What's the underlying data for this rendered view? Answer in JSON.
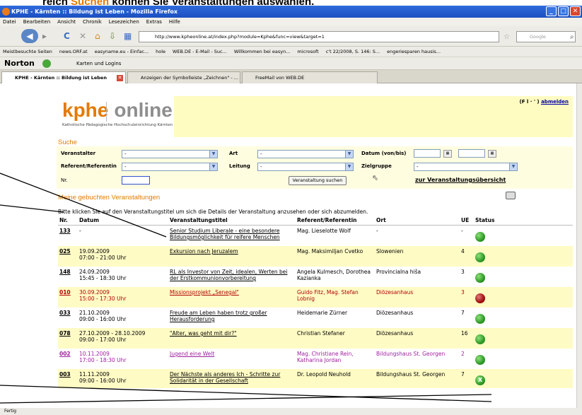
{
  "caption": {
    "prefix": "reich ",
    "highlight": "Suchen",
    "suffix": " können Sie Veranstaltungen auswählen."
  },
  "window": {
    "title": "KPHE - Kärnten :: Bildung ist Leben - Mozilla Firefox"
  },
  "menu": [
    "Datei",
    "Bearbeiten",
    "Ansicht",
    "Chronik",
    "Lesezeichen",
    "Extras",
    "Hilfe"
  ],
  "url": "http://www.kpheonline.at/index.php?module=Kphe&func=view&target=1",
  "search_engine": "Google",
  "bookmarks": [
    "Meistbesuchte Seiten",
    "news.ORF.at",
    "easyname.eu - Einfac...",
    "hole",
    "WEB.DE - E-Mail - Suc...",
    "Willkommen bei easyn...",
    "microsoft",
    "c't 22/2008, S. 146: S...",
    "engeriesparen hausis..."
  ],
  "norton": {
    "label": "Norton",
    "karten": "Karten und Logins"
  },
  "tabs": [
    "KPHE - Kärnten :: Bildung ist Leben",
    "Anzeigen der Symbolleiste „Zeichnen\" - ...",
    "FreeMail von WEB.DE"
  ],
  "statusbar": "Fertig",
  "page": {
    "logo_kphe": "kphe",
    "logo_online": "online",
    "logo_sub": "Katholische Pädagogische Hochschuleinrichtung Kärnten",
    "user_prefix": "(F  l  ·  ' )",
    "logout": "abmelden",
    "search": {
      "title": "Suche",
      "veranstalter": "Veranstalter",
      "art": "Art",
      "datum": "Datum (von/bis)",
      "referent": "Referent/Referentin",
      "leitung": "Leitung",
      "zielgruppe": "Zielgruppe",
      "nr": "Nr.",
      "select_default": "-",
      "button": "Veranstaltung suchen",
      "overview": "zur Veranstaltungsübersicht"
    },
    "booked": {
      "title": "Meine gebuchten Veranstaltungen",
      "hint": "Bitte klicken Sie auf den Veranstaltungstitel um sich die Details der Veranstaltung anzusehen oder sich abzumelden.",
      "headers": [
        "Nr.",
        "Datum",
        "Veranstaltungstitel",
        "Referent/Referentin",
        "Ort",
        "UE",
        "Status"
      ],
      "rows": [
        {
          "nr": "133",
          "date1": "-",
          "date2": "",
          "title": "Senior Studium Liberale - eine besondere Bildungsmöglichkeit für reifere Menschen",
          "ref": "Mag. Lieselotte Wolf",
          "ort": "-",
          "ue": "-",
          "status": "green",
          "style": "w"
        },
        {
          "nr": "025",
          "date1": "19.09.2009",
          "date2": "07:00 - 21:00 Uhr",
          "title": "Exkursion nach Jeruzalem",
          "ref": "Mag. Maksimiljan Cvetko",
          "ort": "Slowenien",
          "ue": "4",
          "status": "green",
          "style": "y"
        },
        {
          "nr": "148",
          "date1": "24.09.2009",
          "date2": "15:45 - 18:30 Uhr",
          "title": "RL als Investor von Zeit, idealen, Werten bei der Erstkommunionvorbereitung",
          "ref": "Angela Kulmesch, Dorothea Kazianka",
          "ort": "Provincialna hiša",
          "ue": "3",
          "status": "green",
          "style": "w"
        },
        {
          "nr": "010",
          "date1": "30.09.2009",
          "date2": "15:00 - 17:30 Uhr",
          "title": "Missionsprojekt „Senegal\"",
          "ref": "Guido Fitz, Mag. Stefan Lobnig",
          "ort": "Diözesanhaus",
          "ue": "3",
          "status": "red",
          "style": "y red"
        },
        {
          "nr": "033",
          "date1": "21.10.2009",
          "date2": "09:00 - 16:00 Uhr",
          "title": "Freude am Leben haben trotz großer Herausforderung",
          "ref": "Heidemarie Zürner",
          "ort": "Diözesanhaus",
          "ue": "7",
          "status": "green",
          "style": "w"
        },
        {
          "nr": "078",
          "date1": "27.10.2009 - 28.10.2009",
          "date2": "09:00 - 17:00 Uhr",
          "title": "\"Alter, was geht mit dir?\"",
          "ref": "Christian Stefaner",
          "ort": "Diözesanhaus",
          "ue": "16",
          "status": "green",
          "style": "y"
        },
        {
          "nr": "002",
          "date1": "10.11.2009",
          "date2": "17:00 - 18:30 Uhr",
          "title": "Jugend eine Welt",
          "ref": "Mag. Christiane Rein, Katharina Jordan",
          "ort": "Bildungshaus St. Georgen",
          "ue": "2",
          "status": "green",
          "style": "w purple"
        },
        {
          "nr": "003",
          "date1": "11.11.2009",
          "date2": "09:00 - 16:00 Uhr",
          "title": "Der Nächste als anderes Ich - Schritte zur Solidarität in der Gesellschaft",
          "ref": "Dr. Leopold Neuhold",
          "ort": "Bildungshaus St. Georgen",
          "ue": "7",
          "status": "x",
          "style": "y"
        }
      ]
    }
  }
}
